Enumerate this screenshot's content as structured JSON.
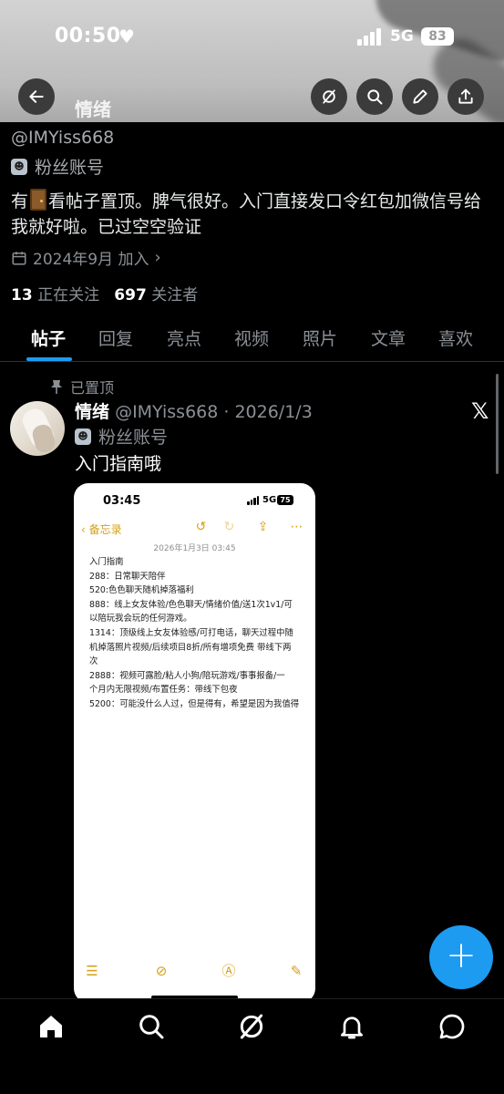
{
  "status_bar": {
    "time": "00:50",
    "network": "5G",
    "battery": "83"
  },
  "header": {
    "title": "情绪"
  },
  "profile": {
    "handle": "@IMYiss668",
    "fan_label": "粉丝账号",
    "bio_part1": "有",
    "bio_part2": "看帖子置顶。脾气很好。入门直接发口令红包加微信号给我就好啦。已过空空验证",
    "joined": "2024年9月 加入",
    "following_count": "13",
    "following_label": "正在关注",
    "followers_count": "697",
    "followers_label": "关注者"
  },
  "tabs": [
    "帖子",
    "回复",
    "亮点",
    "视频",
    "照片",
    "文章",
    "喜欢"
  ],
  "post": {
    "pinned_label": "已置顶",
    "name": "情绪",
    "handle_date": "@IMYiss668 · 2026/1/3",
    "fan_label": "粉丝账号",
    "text": "入门指南哦",
    "x_logo": "𝕏"
  },
  "embedded_note": {
    "time": "03:45",
    "network": "5G",
    "battery": "75",
    "back_label": "备忘录",
    "date": "2026年1月3日 03:45",
    "lines": [
      "入门指南",
      "288：日常聊天陪伴",
      "520:色色聊天随机掉落福利",
      "888：线上女友体验/色色聊天/情绪价值/送1次1v1/可",
      "以陪玩我会玩的任何游戏。",
      "1314：顶级线上女友体验感/可打电话，聊天过程中随",
      "机掉落照片视频/后续项目8折/所有增项免费 带线下两",
      "次",
      "2888：视频可露脸/粘人小狗/陪玩游戏/事事报备/一",
      "个月内无限视频/布置任务：带线下包夜",
      "5200：可能没什么人过，但是得有，希望是因为我值得"
    ]
  },
  "fab": {
    "label": "+"
  },
  "colors": {
    "accent": "#1d9bf0",
    "background": "#000000",
    "secondary_text": "#8b9096",
    "note_accent": "#d4a017"
  }
}
